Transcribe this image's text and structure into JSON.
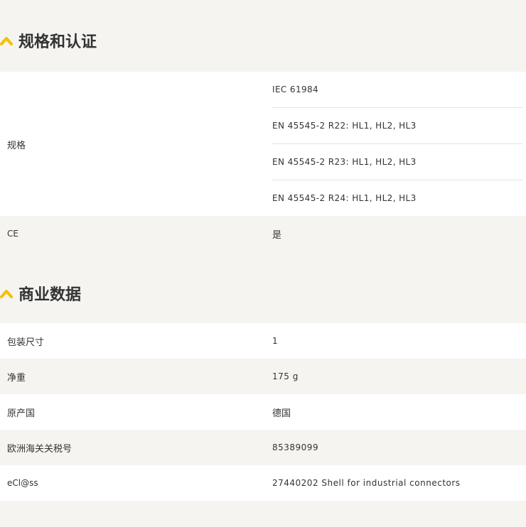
{
  "colors": {
    "accent": "#f2c200",
    "page_bg": "#f5f4f0",
    "row_bg": "#ffffff",
    "text": "#333333"
  },
  "certifications": {
    "title": "规格和认证",
    "toggle_icon": "chevron-up-icon",
    "spec_label": "规格",
    "specs": [
      "IEC 61984",
      "EN 45545-2 R22: HL1, HL2, HL3",
      "EN 45545-2 R23: HL1, HL2, HL3",
      "EN 45545-2 R24: HL1, HL2, HL3"
    ],
    "ce_label": "CE",
    "ce_value": "是"
  },
  "commercial": {
    "title": "商业数据",
    "toggle_icon": "chevron-up-icon",
    "rows": [
      {
        "label": "包装尺寸",
        "value": "1"
      },
      {
        "label": "净重",
        "value": "175 g"
      },
      {
        "label": "原产国",
        "value": "德国"
      },
      {
        "label": "欧洲海关关税号",
        "value": "85389099"
      },
      {
        "label": "eCl@ss",
        "value": "27440202 Shell for industrial connectors"
      }
    ]
  }
}
